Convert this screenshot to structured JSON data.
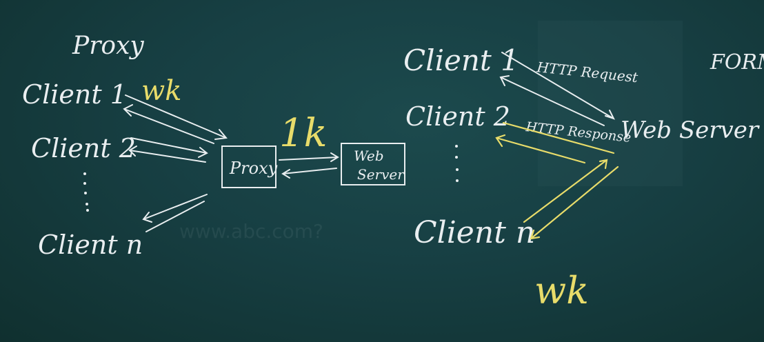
{
  "left": {
    "title": "Proxy",
    "clients": [
      "Client 1",
      "Client 2",
      "Client n"
    ],
    "proxy_box": "Proxy",
    "server_box": [
      "Web",
      "Server"
    ],
    "many_k": "wk",
    "one_k": "1k"
  },
  "right": {
    "clients": [
      "Client 1",
      "Client 2",
      "Client n"
    ],
    "server": "Web Server",
    "request": "HTTP Request",
    "response": "HTTP Response",
    "many_k": "wk",
    "edge_text": "FORM"
  },
  "faint": {
    "url": "www.abc.com?"
  },
  "colors": {
    "board": "#173f43",
    "chalk": "#e9eef0",
    "yellow": "#e8dc6a"
  }
}
